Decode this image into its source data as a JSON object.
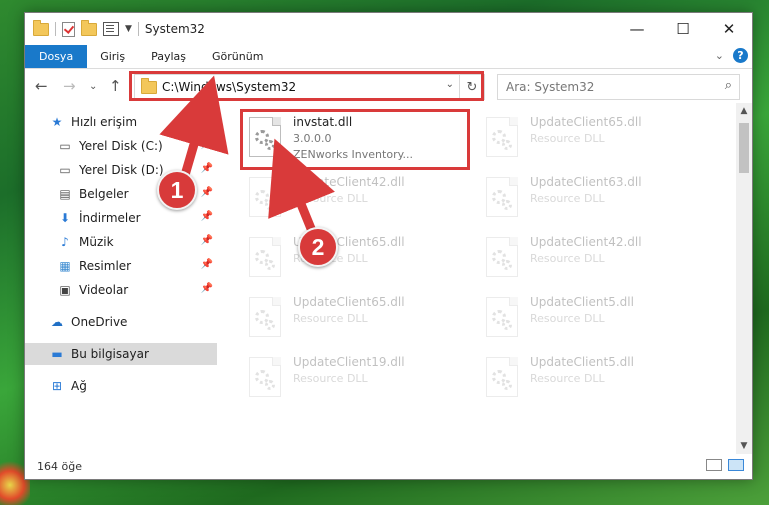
{
  "window": {
    "title": "System32",
    "controls": {
      "minimize": "—",
      "maximize": "☐",
      "close": "✕"
    }
  },
  "ribbon": {
    "tabs": [
      "Dosya",
      "Giriş",
      "Paylaş",
      "Görünüm"
    ],
    "help": "?"
  },
  "address": {
    "path": "C:\\Windows\\System32",
    "search_placeholder": "Ara: System32"
  },
  "sidebar": {
    "items": [
      {
        "label": "Hızlı erişim",
        "icon": "star-icon"
      },
      {
        "label": "Yerel Disk (C:)",
        "icon": "drive-icon",
        "pinned": true
      },
      {
        "label": "Yerel Disk (D:)",
        "icon": "drive-icon",
        "pinned": true
      },
      {
        "label": "Belgeler",
        "icon": "documents-icon",
        "pinned": true
      },
      {
        "label": "İndirmeler",
        "icon": "download-icon",
        "pinned": true
      },
      {
        "label": "Müzik",
        "icon": "music-icon",
        "pinned": true
      },
      {
        "label": "Resimler",
        "icon": "pictures-icon",
        "pinned": true
      },
      {
        "label": "Videolar",
        "icon": "videos-icon",
        "pinned": true
      },
      {
        "label": "OneDrive",
        "icon": "cloud-icon"
      },
      {
        "label": "Bu bilgisayar",
        "icon": "computer-icon",
        "selected": true
      },
      {
        "label": "Ağ",
        "icon": "network-icon"
      }
    ]
  },
  "files": [
    {
      "name": "invstat.dll",
      "line1": "3.0.0.0",
      "line2": "ZENworks   Inventory..."
    },
    {
      "name": "UpdateClient65.dll",
      "line1": "Resource DLL"
    },
    {
      "name": "UpdateClient42.dll",
      "line1": "Resource DLL"
    },
    {
      "name": "UpdateClient63.dll",
      "line1": "Resource DLL"
    },
    {
      "name": "UpdateClient65.dll",
      "line1": "Resource DLL"
    },
    {
      "name": "UpdateClient42.dll",
      "line1": "Resource DLL"
    },
    {
      "name": "UpdateClient65.dll",
      "line1": "Resource DLL"
    },
    {
      "name": "UpdateClient5.dll",
      "line1": "Resource DLL"
    },
    {
      "name": "UpdateClient19.dll",
      "line1": "Resource DLL"
    },
    {
      "name": "UpdateClient5.dll",
      "line1": "Resource DLL"
    }
  ],
  "status": {
    "count": "164 öğe"
  },
  "annotations": {
    "step1": "1",
    "step2": "2",
    "color": "#d93a3a"
  }
}
